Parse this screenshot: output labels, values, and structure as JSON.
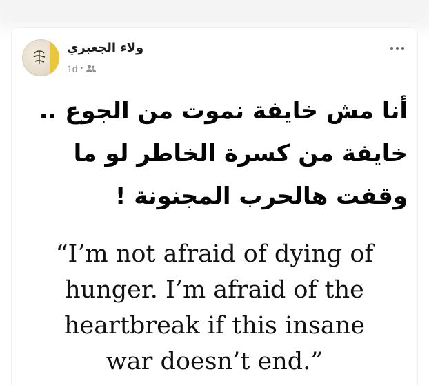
{
  "post": {
    "author_name": "ولاء الجعبري",
    "timestamp": "1d",
    "audience_icon": "friends-icon",
    "more_icon": "more-horizontal-icon",
    "arabic_lines": [
      "أنا مش خايفة نموت من الجوع ..",
      "خايفة من كسرة الخاطر لو ما",
      "وقفت هالحرب المجنونة !"
    ],
    "english_lines": [
      "“I’m not afraid of dying of",
      "hunger. I’m afraid of the",
      "heartbreak if this insane",
      "war doesn’t end.”"
    ]
  },
  "colors": {
    "name_text": "#1c1e21",
    "meta_text": "#8a8d91",
    "body_text": "#050505",
    "avatar_accent": "#e8c640"
  }
}
